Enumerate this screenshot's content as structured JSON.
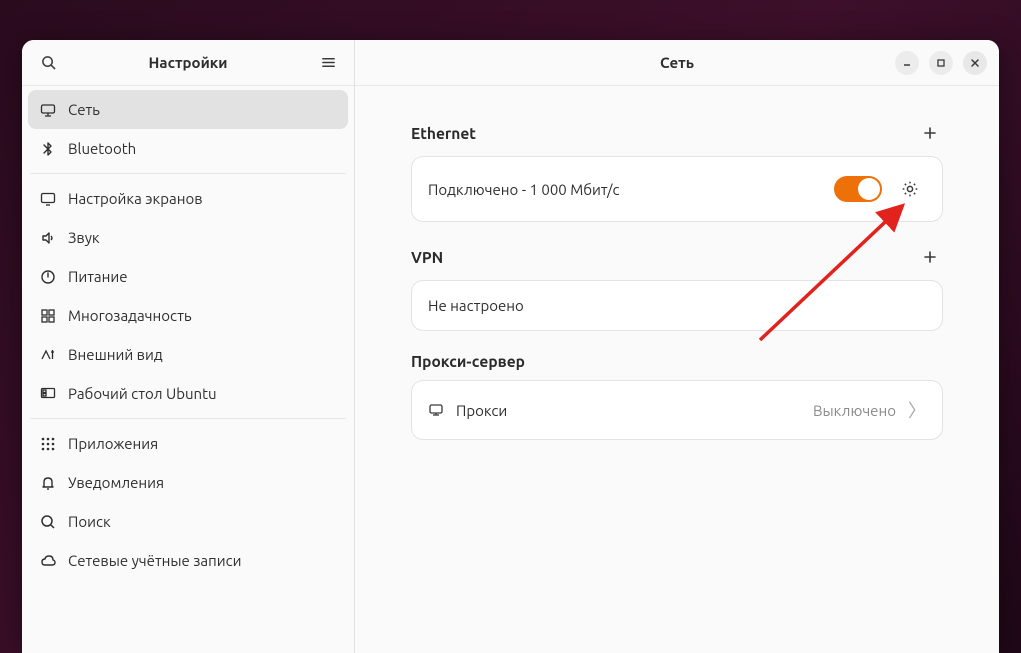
{
  "sidebar": {
    "title": "Настройки",
    "items": [
      {
        "label": "Сеть"
      },
      {
        "label": "Bluetooth"
      },
      {
        "label": "Настройка экранов"
      },
      {
        "label": "Звук"
      },
      {
        "label": "Питание"
      },
      {
        "label": "Многозадачность"
      },
      {
        "label": "Внешний вид"
      },
      {
        "label": "Рабочий стол Ubuntu"
      },
      {
        "label": "Приложения"
      },
      {
        "label": "Уведомления"
      },
      {
        "label": "Поиск"
      },
      {
        "label": "Сетевые учётные записи"
      }
    ]
  },
  "main": {
    "title": "Сеть",
    "sections": {
      "ethernet": {
        "title": "Ethernet",
        "status": "Подключено - 1 000 Мбит/с",
        "enabled": true
      },
      "vpn": {
        "title": "VPN",
        "status": "Не настроено"
      },
      "proxy": {
        "title": "Прокси-сервер",
        "row_label": "Прокси",
        "row_value": "Выключено"
      }
    }
  },
  "colors": {
    "accent": "#ed7108"
  }
}
